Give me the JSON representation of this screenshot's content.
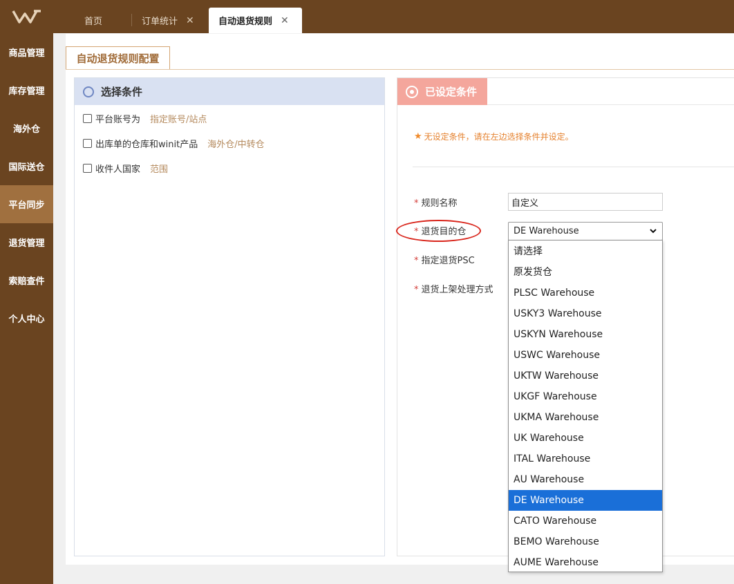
{
  "tabs": [
    {
      "label": "首页",
      "closable": false
    },
    {
      "label": "订单统计",
      "closable": true
    },
    {
      "label": "自动退货规则",
      "closable": true,
      "active": true
    }
  ],
  "tab_close_glyph": "✕",
  "sidebar": {
    "items": [
      {
        "label": "商品管理"
      },
      {
        "label": "库存管理"
      },
      {
        "label": "海外仓"
      },
      {
        "label": "国际送仓"
      },
      {
        "label": "平台同步",
        "active": true
      },
      {
        "label": "退货管理"
      },
      {
        "label": "索赔查件"
      },
      {
        "label": "个人中心"
      }
    ]
  },
  "page_tab": "自动退货规则配置",
  "left_panel": {
    "title": "选择条件",
    "conditions": [
      {
        "label": "平台账号为",
        "hint": "指定账号/站点"
      },
      {
        "label": "出库单的仓库和winit产品",
        "hint": "海外仓/中转仓"
      },
      {
        "label": "收件人国家",
        "hint": "范围"
      }
    ]
  },
  "right_panel": {
    "title": "已设定条件",
    "notice": "无设定条件，请在左边选择条件并设定。",
    "fields": {
      "rule_name_label": "规则名称",
      "rule_name_value": "自定义",
      "dest_label": "退货目的仓",
      "dest_value": "DE Warehouse",
      "psc_label": "指定退货PSC",
      "shelf_label": "退货上架处理方式"
    }
  },
  "dropdown": {
    "options": [
      "请选择",
      "原发货仓",
      "PLSC Warehouse",
      "USKY3 Warehouse",
      "USKYN Warehouse",
      "USWC Warehouse",
      "UKTW Warehouse",
      "UKGF Warehouse",
      "UKMA Warehouse",
      "UK Warehouse",
      "ITAL Warehouse",
      "AU Warehouse",
      "DE Warehouse",
      "CATO Warehouse",
      "BEMO Warehouse",
      "AUME Warehouse"
    ],
    "selected": "DE Warehouse"
  },
  "colors": {
    "brand_brown": "#6a4420",
    "sidebar_active": "#a0703f",
    "accent_pink": "#f4a69c",
    "selection_blue": "#1a6fd8",
    "annotation_red": "#d9261c"
  },
  "icons": {
    "logo": "winit-logo-icon",
    "select_condition": "ring-icon",
    "set_condition": "target-icon",
    "notice": "star-icon",
    "select": "chevron-down-icon"
  }
}
